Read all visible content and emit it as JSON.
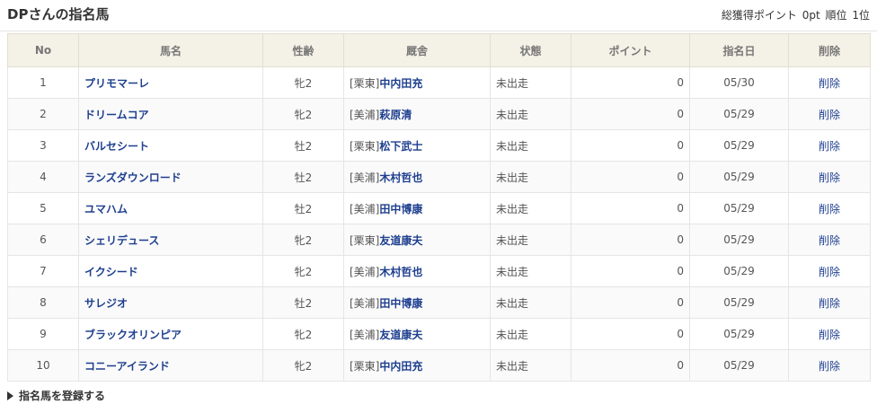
{
  "header": {
    "title": "DPさんの指名馬",
    "summary_prefix": "総獲得ポイント",
    "total_points": "0pt",
    "rank_label": "順位",
    "rank": "1位"
  },
  "table": {
    "columns": [
      "No",
      "馬名",
      "性齢",
      "厩舎",
      "状態",
      "ポイント",
      "指名日",
      "削除"
    ],
    "rows": [
      {
        "no": "1",
        "name": "プリモマーレ",
        "sex_age": "牝2",
        "region": "[栗東]",
        "trainer": "中内田充",
        "status": "未出走",
        "points": "0",
        "date": "05/30",
        "delete": "削除"
      },
      {
        "no": "2",
        "name": "ドリームコア",
        "sex_age": "牝2",
        "region": "[美浦]",
        "trainer": "萩原清",
        "status": "未出走",
        "points": "0",
        "date": "05/29",
        "delete": "削除"
      },
      {
        "no": "3",
        "name": "バルセシート",
        "sex_age": "牡2",
        "region": "[栗東]",
        "trainer": "松下武士",
        "status": "未出走",
        "points": "0",
        "date": "05/29",
        "delete": "削除"
      },
      {
        "no": "4",
        "name": "ランズダウンロード",
        "sex_age": "牡2",
        "region": "[美浦]",
        "trainer": "木村哲也",
        "status": "未出走",
        "points": "0",
        "date": "05/29",
        "delete": "削除"
      },
      {
        "no": "5",
        "name": "ユマハム",
        "sex_age": "牡2",
        "region": "[美浦]",
        "trainer": "田中博康",
        "status": "未出走",
        "points": "0",
        "date": "05/29",
        "delete": "削除"
      },
      {
        "no": "6",
        "name": "シェリデュース",
        "sex_age": "牝2",
        "region": "[栗東]",
        "trainer": "友道康夫",
        "status": "未出走",
        "points": "0",
        "date": "05/29",
        "delete": "削除"
      },
      {
        "no": "7",
        "name": "イクシード",
        "sex_age": "牝2",
        "region": "[美浦]",
        "trainer": "木村哲也",
        "status": "未出走",
        "points": "0",
        "date": "05/29",
        "delete": "削除"
      },
      {
        "no": "8",
        "name": "サレジオ",
        "sex_age": "牡2",
        "region": "[美浦]",
        "trainer": "田中博康",
        "status": "未出走",
        "points": "0",
        "date": "05/29",
        "delete": "削除"
      },
      {
        "no": "9",
        "name": "ブラックオリンピア",
        "sex_age": "牝2",
        "region": "[美浦]",
        "trainer": "友道康夫",
        "status": "未出走",
        "points": "0",
        "date": "05/29",
        "delete": "削除"
      },
      {
        "no": "10",
        "name": "コニーアイランド",
        "sex_age": "牝2",
        "region": "[栗東]",
        "trainer": "中内田充",
        "status": "未出走",
        "points": "0",
        "date": "05/29",
        "delete": "削除"
      }
    ]
  },
  "footer": {
    "register_label": "指名馬を登録する",
    "register_icon": "triangle-right-icon"
  },
  "colors": {
    "link": "#1e3f8f",
    "header_bg": "#f4f1e6"
  }
}
